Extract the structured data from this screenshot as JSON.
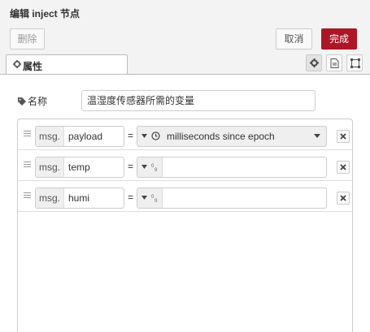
{
  "dialog": {
    "title": "编辑 inject 节点"
  },
  "toolbar": {
    "delete_label": "删除",
    "cancel_label": "取消",
    "done_label": "完成"
  },
  "tabs": [
    {
      "label": "属性",
      "icon": "gear-icon"
    }
  ],
  "tab_buttons": [
    "gear-icon",
    "document-icon",
    "frame-icon"
  ],
  "form": {
    "name_label": "名称",
    "name_value": "温湿度传感器所需的变量"
  },
  "props": [
    {
      "prefix": "msg.",
      "property": "payload",
      "type": "timestamp",
      "value": "milliseconds since epoch"
    },
    {
      "prefix": "msg.",
      "property": "temp",
      "type": "number",
      "type_icon": "09",
      "value": ""
    },
    {
      "prefix": "msg.",
      "property": "humi",
      "type": "number",
      "type_icon": "09",
      "value": ""
    }
  ],
  "colors": {
    "accent": "#ad1625",
    "background": "#f3f3f3"
  }
}
